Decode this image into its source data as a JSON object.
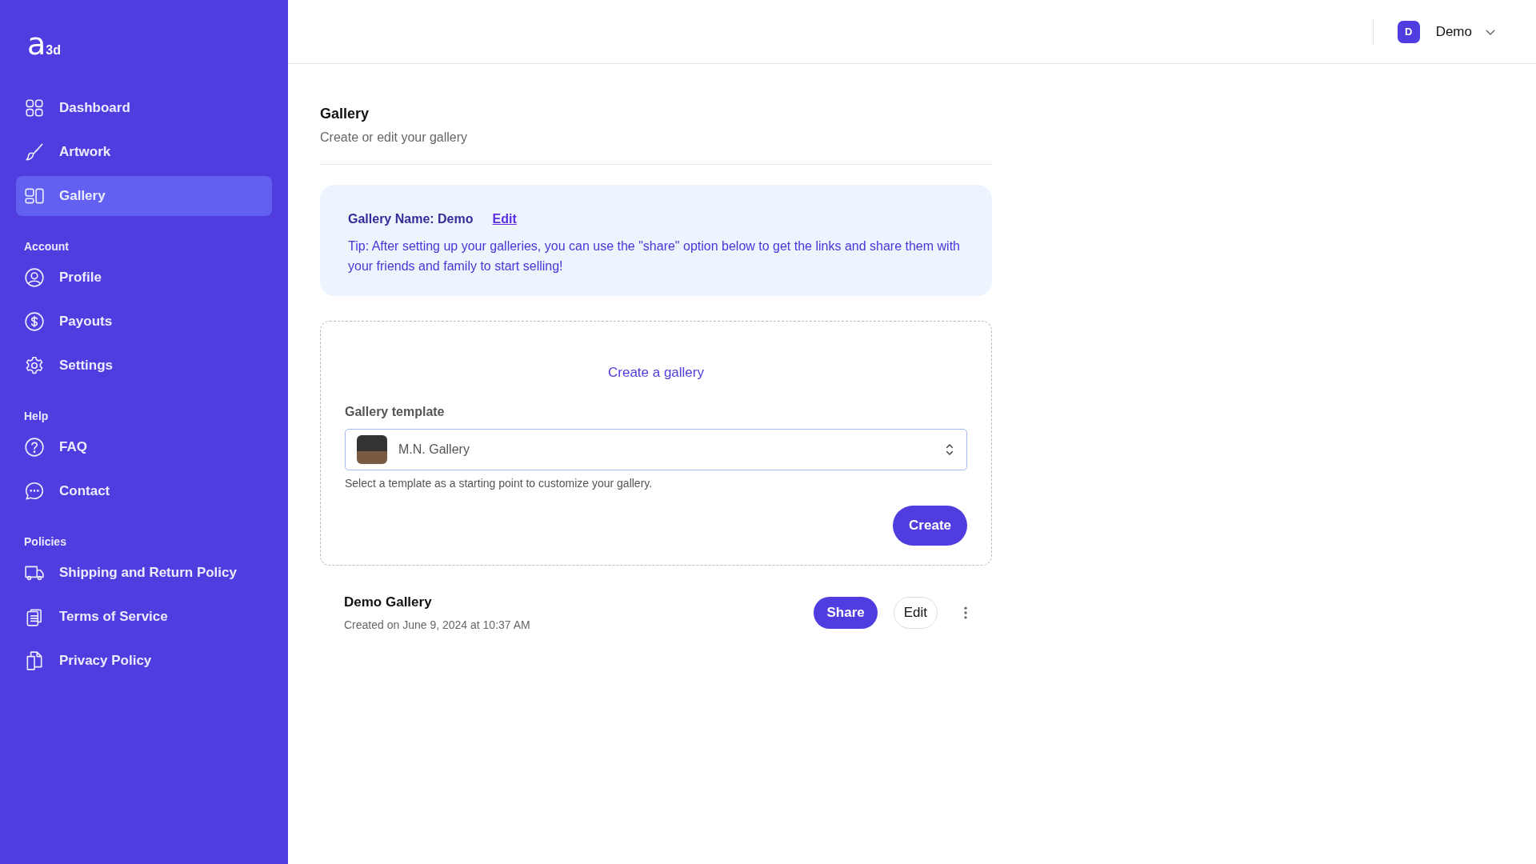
{
  "logo": {
    "mark": "a",
    "suffix": "3d"
  },
  "sidebar": {
    "sections": [
      {
        "items": [
          {
            "label": "Dashboard",
            "kind": "grid",
            "selected": false
          },
          {
            "label": "Artwork",
            "kind": "brush",
            "selected": false
          },
          {
            "label": "Gallery",
            "kind": "layout",
            "selected": true
          }
        ]
      },
      {
        "heading": "Account",
        "items": [
          {
            "label": "Profile",
            "kind": "user",
            "selected": false
          },
          {
            "label": "Payouts",
            "kind": "dollar",
            "selected": false
          },
          {
            "label": "Settings",
            "kind": "gear",
            "selected": false
          }
        ]
      },
      {
        "heading": "Help",
        "items": [
          {
            "label": "FAQ",
            "kind": "question",
            "selected": false
          },
          {
            "label": "Contact",
            "kind": "chat",
            "selected": false
          }
        ]
      },
      {
        "heading": "Policies",
        "items": [
          {
            "label": "Shipping and Return Policy",
            "kind": "truck",
            "selected": false
          },
          {
            "label": "Terms of Service",
            "kind": "clipboard",
            "selected": false
          },
          {
            "label": "Privacy Policy",
            "kind": "files",
            "selected": false
          }
        ]
      }
    ]
  },
  "header": {
    "user": {
      "initial": "D",
      "name": "Demo"
    }
  },
  "page": {
    "title": "Gallery",
    "subtitle": "Create or edit your gallery"
  },
  "info": {
    "name_label": "Gallery Name: Demo",
    "edit_link": "Edit",
    "tip": "Tip: After setting up your galleries, you can use the \"share\" option below to get the links and share them with your friends and family to start selling!"
  },
  "create": {
    "title": "Create a gallery",
    "field_label": "Gallery template",
    "value": "M.N. Gallery",
    "help": "Select a template as a starting point to customize your gallery.",
    "button": "Create"
  },
  "galleries": [
    {
      "name": "Demo Gallery",
      "created": "Created on June 9, 2024 at 10:37 AM",
      "share": "Share",
      "edit": "Edit"
    }
  ]
}
